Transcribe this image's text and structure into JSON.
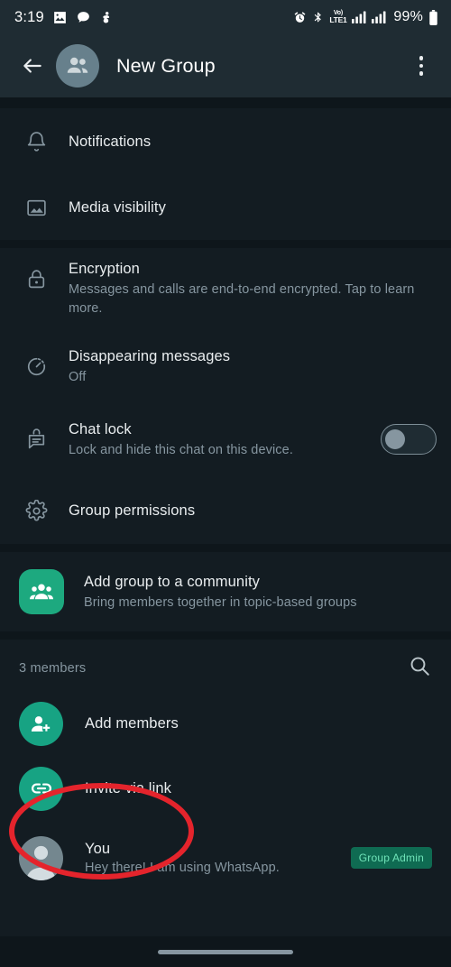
{
  "status_bar": {
    "time": "3:19",
    "left_icons": [
      "photo-icon",
      "chat-bubble-icon",
      "app-icon"
    ],
    "right_icons": [
      "alarm-icon",
      "bluetooth-icon",
      "volte-icon",
      "signal-bars-1-icon",
      "signal-bars-2-icon"
    ],
    "volte_top": "Vo)",
    "volte_bottom": "LTE1",
    "battery": "99%"
  },
  "app_bar": {
    "back_icon": "back-arrow-icon",
    "avatar_icon": "group-avatar-icon",
    "title": "New Group",
    "menu_icon": "overflow-menu-icon"
  },
  "settings": {
    "section1": [
      {
        "icon": "bell-icon",
        "title": "Notifications",
        "subtitle": ""
      },
      {
        "icon": "image-icon",
        "title": "Media visibility",
        "subtitle": ""
      }
    ],
    "section2": [
      {
        "icon": "lock-icon",
        "title": "Encryption",
        "subtitle": "Messages and calls are end-to-end encrypted. Tap to learn more."
      },
      {
        "icon": "timer-icon",
        "title": "Disappearing messages",
        "subtitle": "Off"
      },
      {
        "icon": "chat-lock-icon",
        "title": "Chat lock",
        "subtitle": "Lock and hide this chat on this device.",
        "toggle": "off"
      },
      {
        "icon": "gear-icon",
        "title": "Group permissions",
        "subtitle": ""
      }
    ],
    "community": {
      "icon": "community-icon",
      "title": "Add group to a community",
      "subtitle": "Bring members together in topic-based groups"
    }
  },
  "members": {
    "header_label": "3 members",
    "search_icon": "search-icon",
    "items": [
      {
        "icon": "add-member-icon",
        "title": "Add members",
        "subtitle": "",
        "badge": ""
      },
      {
        "icon": "link-icon",
        "title": "Invite via link",
        "subtitle": "",
        "badge": ""
      },
      {
        "icon": "person-avatar-icon",
        "title": "You",
        "subtitle": "Hey there! I am using WhatsApp.",
        "badge": "Group Admin"
      }
    ]
  },
  "annotation": {
    "shape": "ellipse",
    "color": "#e4242c",
    "targets": "Invite via link"
  },
  "nav_bar": {
    "handle": "home-gesture-handle"
  },
  "colors": {
    "app_bar": "#1f2c33",
    "background": "#131c22",
    "divider": "#0e161b",
    "accent_green": "#17a383",
    "community_green": "#1da97f",
    "badge_bg": "#0f6b52",
    "badge_text": "#6fe3b8",
    "primary_text": "#e9edef",
    "secondary_text": "#8696a0",
    "annotation_red": "#e4242c"
  }
}
